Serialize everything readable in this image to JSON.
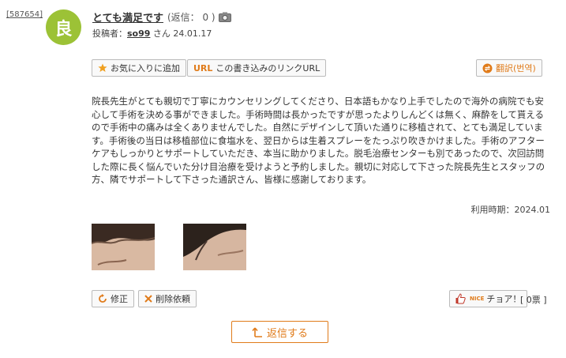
{
  "post": {
    "id": "[587654]",
    "avatar_char": "良",
    "title": "とても満足です",
    "reply_count": "(返信： 0 )",
    "author_label": "投稿者：",
    "author": "so99",
    "author_suffix": "さん",
    "date": "24.01.17"
  },
  "toolbar": {
    "favorite_label": "お気に入りに追加",
    "url_tag": "URL",
    "link_label": "この書き込みのリンクURL",
    "translate_label": "翻訳(번역)"
  },
  "body": "院長先生がとても親切で丁寧にカウンセリングしてくださり、日本語もかなり上手でしたので海外の病院でも安心して手術を決める事ができました。手術時間は長かったですが思ったよりしんどくは無く、麻酔をして貰えるので手術中の痛みは全くありませんでした。自然にデザインして頂いた通りに移植されて、とても満足しています。手術後の当日は移植部位に食塩水を、翌日からは生着スプレーをたっぷり吹きかけました。手術のアフターケアもしっかりとサポートしていただき、本当に助かりました。脱毛治療センターも別であったので、次回訪問した際に長く悩んでいた分け目治療を受けようと予約しました。親切に対応して下さった院長先生とスタッフの方、隣でサポートして下さった通訳さん、皆様に感謝しております。",
  "usage": "利用時期：2024.01",
  "actions": {
    "edit_label": "修正",
    "delete_label": "削除依頼",
    "nice_tag": "NICE",
    "nice_label": "チョア！",
    "nice_count": "[ 0票 ]",
    "reply_label": "返信する"
  },
  "colors": {
    "accent": "#e07b1a",
    "avatar": "#9cc236"
  },
  "icons": [
    "camera-icon",
    "star-icon",
    "translate-icon",
    "refresh-icon",
    "close-icon",
    "hand-icon",
    "reply-arrow-icon"
  ]
}
